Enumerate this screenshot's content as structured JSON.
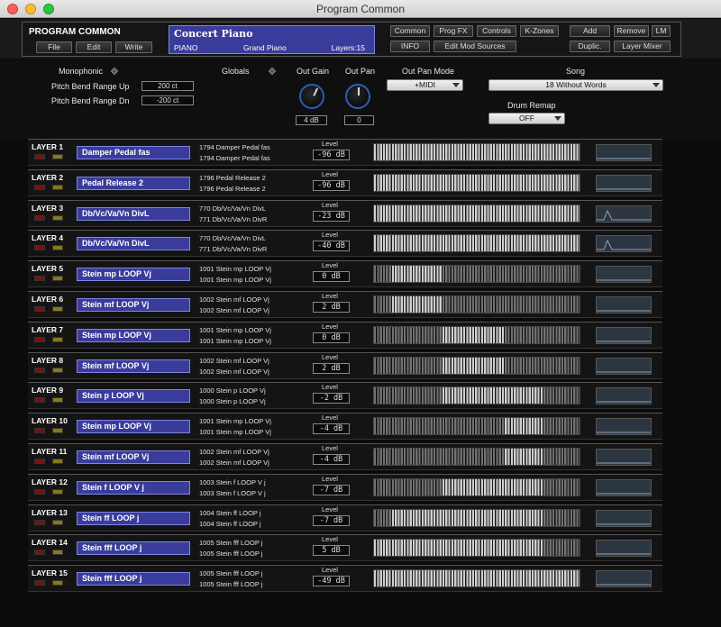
{
  "window": {
    "title": "Program Common"
  },
  "header": {
    "section_title": "PROGRAM COMMON",
    "file_button": "File",
    "edit_button": "Edit",
    "write_button": "Write",
    "program": {
      "name": "Concert Piano",
      "category": "PIANO",
      "subcategory": "Grand Piano",
      "layers": "Layers:15"
    },
    "tabs": {
      "common": "Common",
      "prog_fx": "Prog FX",
      "controls": "Controls",
      "k_zones": "K-Zones",
      "info": "INFO",
      "edit_mod_sources": "Edit Mod Sources"
    },
    "layer_buttons": {
      "add": "Add",
      "remove": "Remove",
      "lm": "LM",
      "duplic": "Duplic.",
      "layer_mixer": "Layer Mixer"
    }
  },
  "globals": {
    "monophonic_label": "Monophonic",
    "pitch_bend_up_label": "Pitch Bend Range Up",
    "pitch_bend_up_value": "200 ct",
    "pitch_bend_dn_label": "Pitch Bend Range Dn",
    "pitch_bend_dn_value": "-200 ct",
    "globals_label": "Globals",
    "out_gain_label": "Out Gain",
    "out_gain_value": "4 dB",
    "out_pan_label": "Out Pan",
    "out_pan_value": "0",
    "out_pan_mode_label": "Out Pan Mode",
    "out_pan_mode_value": "+MIDI",
    "song_label": "Song",
    "song_value": "18 Without Words",
    "drum_remap_label": "Drum Remap",
    "drum_remap_value": "OFF"
  },
  "level_label": "Level",
  "layers": [
    {
      "label": "LAYER 1",
      "name": "Damper Pedal fas",
      "km1": "1794 Damper Pedal fas",
      "km2": "1794 Damper Pedal fas",
      "level": "-96 dB",
      "range": [
        0,
        1
      ],
      "env": false
    },
    {
      "label": "LAYER 2",
      "name": "Pedal Release 2",
      "km1": "1796 Pedal Release 2",
      "km2": "1796 Pedal Release 2",
      "level": "-96 dB",
      "range": [
        0,
        1
      ],
      "env": false
    },
    {
      "label": "LAYER 3",
      "name": "Db/Vc/Va/Vn DivL",
      "km1": "770 Db/Vc/Va/Vn DivL",
      "km2": "771 Db/Vc/Va/Vn DivR",
      "level": "-23 dB",
      "range": [
        0,
        1
      ],
      "env": true
    },
    {
      "label": "LAYER 4",
      "name": "Db/Vc/Va/Vn DivL",
      "km1": "770 Db/Vc/Va/Vn DivL",
      "km2": "771 Db/Vc/Va/Vn DivR",
      "level": "-40 dB",
      "range": [
        0,
        1
      ],
      "env": true
    },
    {
      "label": "LAYER 5",
      "name": "Stein mp LOOP Vj",
      "km1": "1001 Stein mp LOOP Vj",
      "km2": "1001 Stein mp LOOP Vj",
      "level": "0 dB",
      "range": [
        0.08,
        0.33
      ],
      "env": false
    },
    {
      "label": "LAYER 6",
      "name": "Stein mf LOOP Vj",
      "km1": "1002 Stein mf LOOP Vj",
      "km2": "1002 Stein mf LOOP Vj",
      "level": "2 dB",
      "range": [
        0.08,
        0.33
      ],
      "env": false
    },
    {
      "label": "LAYER 7",
      "name": "Stein mp LOOP Vj",
      "km1": "1001 Stein mp LOOP Vj",
      "km2": "1001 Stein mp LOOP Vj",
      "level": "0 dB",
      "range": [
        0.33,
        0.63
      ],
      "env": false
    },
    {
      "label": "LAYER 8",
      "name": "Stein mf LOOP Vj",
      "km1": "1002 Stein mf LOOP Vj",
      "km2": "1002 Stein mf LOOP Vj",
      "level": "2 dB",
      "range": [
        0.33,
        0.63
      ],
      "env": false
    },
    {
      "label": "LAYER 9",
      "name": "Stein p LOOP Vj",
      "km1": "1000 Stein p LOOP Vj",
      "km2": "1000 Stein p LOOP Vj",
      "level": "-2 dB",
      "range": [
        0.33,
        0.82
      ],
      "env": false
    },
    {
      "label": "LAYER 10",
      "name": "Stein mp LOOP Vj",
      "km1": "1001 Stein mp LOOP Vj",
      "km2": "1001 Stein mp LOOP Vj",
      "level": "-4 dB",
      "range": [
        0.63,
        0.82
      ],
      "env": false
    },
    {
      "label": "LAYER 11",
      "name": "Stein mf LOOP Vj",
      "km1": "1002 Stein mf LOOP Vj",
      "km2": "1002 Stein mf LOOP Vj",
      "level": "-4 dB",
      "range": [
        0.63,
        0.82
      ],
      "env": false
    },
    {
      "label": "LAYER 12",
      "name": "Stein f LOOP V j",
      "km1": "1003 Stein f LOOP V j",
      "km2": "1003 Stein f LOOP V j",
      "level": "-7 dB",
      "range": [
        0.33,
        0.82
      ],
      "env": false
    },
    {
      "label": "LAYER 13",
      "name": "Stein ff LOOP j",
      "km1": "1004 Stein ff LOOP j",
      "km2": "1004 Stein ff LOOP j",
      "level": "-7 dB",
      "range": [
        0.08,
        0.82
      ],
      "env": false
    },
    {
      "label": "LAYER 14",
      "name": "Stein fff LOOP j",
      "km1": "1005 Stein fff LOOP j",
      "km2": "1005 Stein fff LOOP j",
      "level": "5 dB",
      "range": [
        0.0,
        0.82
      ],
      "env": false
    },
    {
      "label": "LAYER 15",
      "name": "Stein fff LOOP j",
      "km1": "1005 Stein fff LOOP j",
      "km2": "1005 Stein fff LOOP j",
      "level": "-49 dB",
      "range": [
        0.0,
        1
      ],
      "env": false
    }
  ]
}
